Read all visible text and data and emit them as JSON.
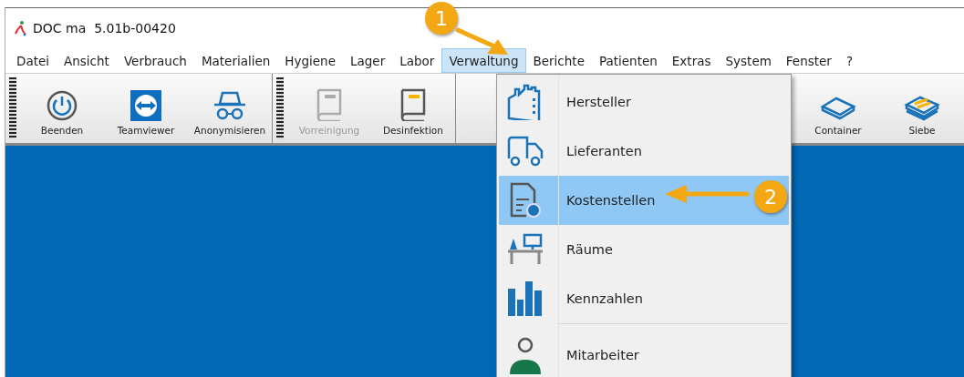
{
  "window": {
    "title": "DOC ma  5.01b-00420"
  },
  "menu_bar": [
    {
      "label": "Datei",
      "selected": false
    },
    {
      "label": "Ansicht",
      "selected": false
    },
    {
      "label": "Verbrauch",
      "selected": false
    },
    {
      "label": "Materialien",
      "selected": false
    },
    {
      "label": "Hygiene",
      "selected": false
    },
    {
      "label": "Lager",
      "selected": false
    },
    {
      "label": "Labor",
      "selected": false
    },
    {
      "label": "Verwaltung",
      "selected": true
    },
    {
      "label": "Berichte",
      "selected": false
    },
    {
      "label": "Patienten",
      "selected": false
    },
    {
      "label": "Extras",
      "selected": false
    },
    {
      "label": "System",
      "selected": false
    },
    {
      "label": "Fenster",
      "selected": false
    },
    {
      "label": "?",
      "selected": false
    }
  ],
  "toolbar": {
    "groups": [
      {
        "items": [
          {
            "label": "Beenden",
            "kind": "power",
            "disabled": false
          },
          {
            "label": "Teamviewer",
            "kind": "teamviewer",
            "disabled": false
          },
          {
            "label": "Anonymisieren",
            "kind": "incognito",
            "disabled": false
          }
        ]
      },
      {
        "items": [
          {
            "label": "Vorreinigung",
            "kind": "book",
            "disabled": true
          },
          {
            "label": "Desinfektion",
            "kind": "book",
            "disabled": false
          }
        ]
      }
    ],
    "trailing_items": [
      {
        "label": "Container",
        "kind": "tray",
        "disabled": false
      },
      {
        "label": "Siebe",
        "kind": "sieve",
        "disabled": false
      }
    ]
  },
  "dropdown": [
    {
      "label": "Hersteller",
      "kind": "factory",
      "selected": false,
      "separator_before": false
    },
    {
      "label": "Lieferanten",
      "kind": "truck",
      "selected": false,
      "separator_before": false
    },
    {
      "label": "Kostenstellen",
      "kind": "invoice",
      "selected": true,
      "separator_before": false
    },
    {
      "label": "Räume",
      "kind": "room",
      "selected": false,
      "separator_before": false
    },
    {
      "label": "Kennzahlen",
      "kind": "chart",
      "selected": false,
      "separator_before": false
    },
    {
      "label": "Mitarbeiter",
      "kind": "person",
      "selected": false,
      "separator_before": true
    }
  ],
  "annotations": [
    {
      "label": "1"
    },
    {
      "label": "2"
    }
  ]
}
